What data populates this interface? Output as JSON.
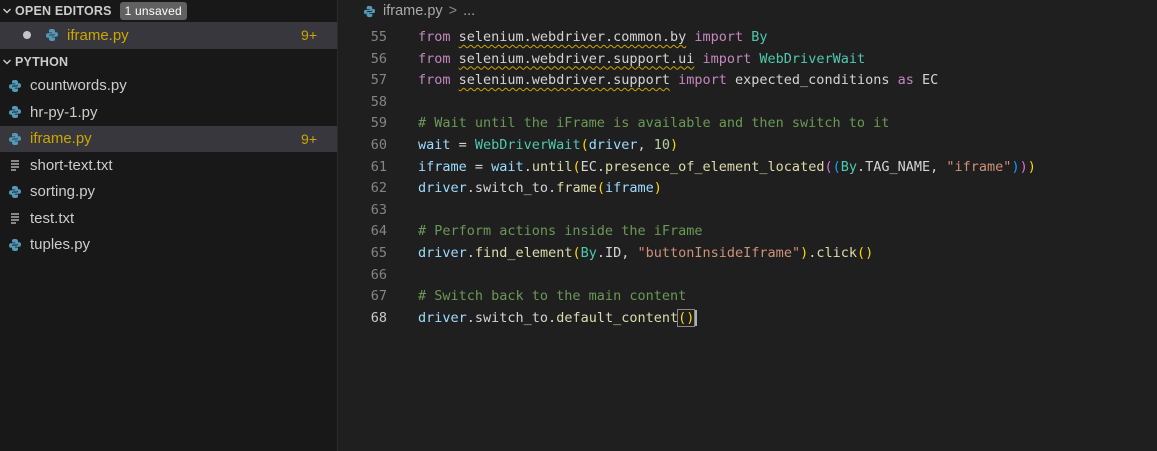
{
  "sidebar": {
    "open_editors": {
      "title": "OPEN EDITORS",
      "badge": "1 unsaved",
      "items": [
        {
          "label": "iframe.py",
          "count": "9+"
        }
      ]
    },
    "workspace": {
      "title": "PYTHON",
      "files": [
        {
          "label": "countwords.py",
          "type": "python"
        },
        {
          "label": "hr-py-1.py",
          "type": "python"
        },
        {
          "label": "iframe.py",
          "type": "python",
          "count": "9+"
        },
        {
          "label": "short-text.txt",
          "type": "text"
        },
        {
          "label": "sorting.py",
          "type": "python"
        },
        {
          "label": "test.txt",
          "type": "text"
        },
        {
          "label": "tuples.py",
          "type": "python"
        }
      ]
    }
  },
  "editor": {
    "breadcrumb": {
      "file": "iframe.py",
      "separator": ">",
      "more": "..."
    },
    "line_numbers": [
      "55",
      "56",
      "57",
      "58",
      "59",
      "60",
      "61",
      "62",
      "63",
      "64",
      "65",
      "66",
      "67",
      "68"
    ]
  },
  "colors": {
    "warning": "#cca700",
    "python_icon": "#519aba",
    "selection": "#37373d"
  }
}
